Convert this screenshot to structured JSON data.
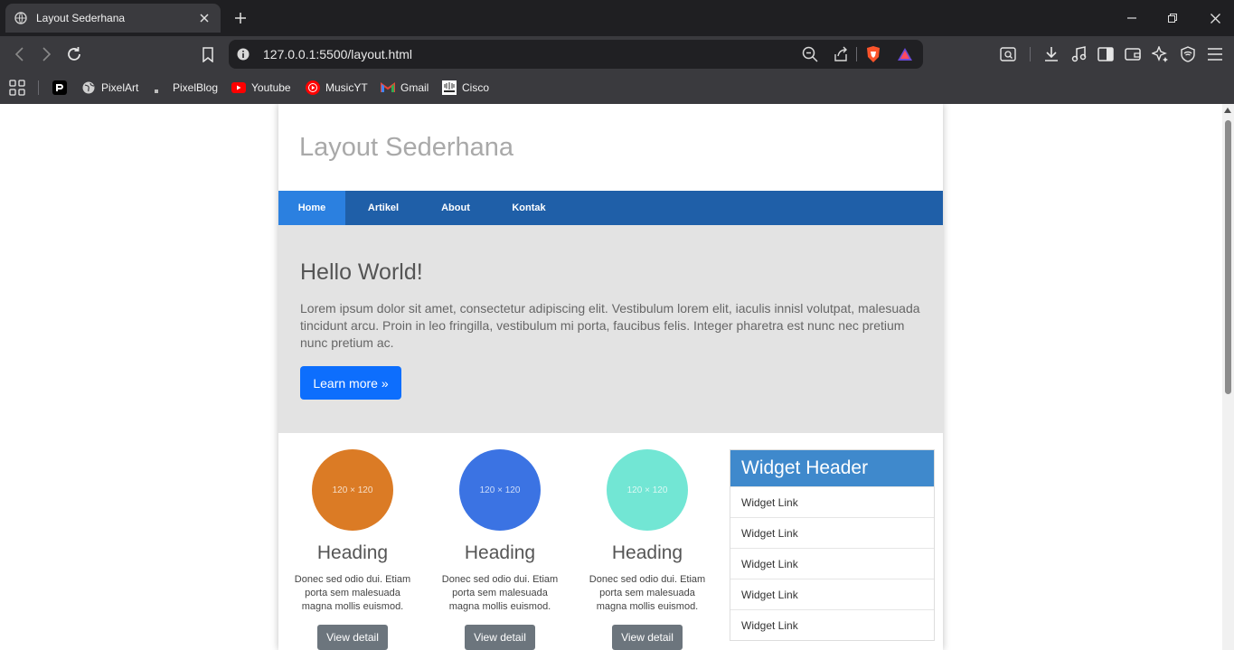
{
  "browser": {
    "tab_title": "Layout Sederhana",
    "url": "127.0.0.1:5500/layout.html",
    "bookmarks": [
      "PixelArt",
      "PixelBlog",
      "Youtube",
      "MusicYT",
      "Gmail",
      "Cisco"
    ]
  },
  "site": {
    "title": "Layout Sederhana",
    "nav": [
      "Home",
      "Artikel",
      "About",
      "Kontak"
    ],
    "nav_active": "Home"
  },
  "hero": {
    "heading": "Hello World!",
    "text": "Lorem ipsum dolor sit amet, consectetur adipiscing elit. Vestibulum lorem elit, iaculis innisl volutpat, malesuada tincidunt arcu. Proin in leo fringilla, vestibulum mi porta, faucibus felis. Integer pharetra est nunc nec pretium nunc pretium ac.",
    "button": "Learn more »"
  },
  "columns": [
    {
      "placeholder": "120 × 120",
      "color": "#db7b25",
      "heading": "Heading",
      "text": "Donec sed odio dui. Etiam porta sem malesuada magna mollis euismod.",
      "button": "View detail"
    },
    {
      "placeholder": "120 × 120",
      "color": "#3b73e3",
      "heading": "Heading",
      "text": "Donec sed odio dui. Etiam porta sem malesuada magna mollis euismod.",
      "button": "View detail"
    },
    {
      "placeholder": "120 × 120",
      "color": "#72e6d4",
      "heading": "Heading",
      "text": "Donec sed odio dui. Etiam porta sem malesuada magna mollis euismod.",
      "button": "View detail"
    }
  ],
  "widget": {
    "header": "Widget Header",
    "links": [
      "Widget Link",
      "Widget Link",
      "Widget Link",
      "Widget Link",
      "Widget Link"
    ]
  },
  "colors": {
    "nav_bg": "#1f5fa8",
    "nav_active": "#2b80e0",
    "hero_bg": "#e3e3e3",
    "primary_button": "#0d6efd",
    "secondary_button": "#6c757d",
    "widget_header": "#3f89cc"
  }
}
